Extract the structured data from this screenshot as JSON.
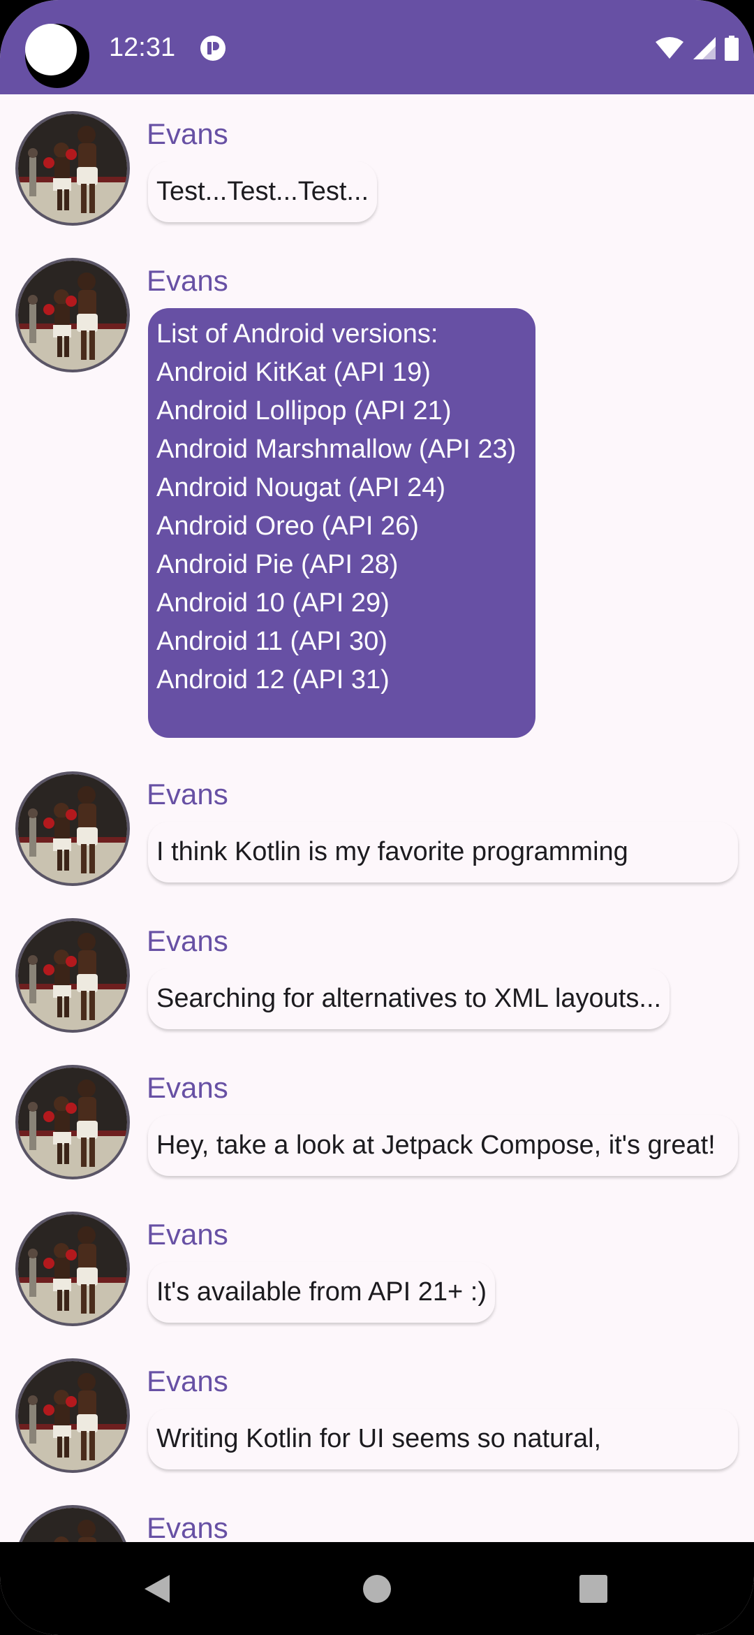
{
  "status_bar": {
    "time": "12:31",
    "icons": [
      "app-notification-icon",
      "wifi-icon",
      "cellular-signal-icon",
      "battery-icon"
    ]
  },
  "colors": {
    "primary": "#6750a4",
    "background": "#fdf7fb",
    "text": "#1c1b1f",
    "on_primary": "#ffffff"
  },
  "messages": [
    {
      "author": "Evans",
      "text": "Test...Test...Test...",
      "expanded": false
    },
    {
      "author": "Evans",
      "expanded": true,
      "lines": [
        "List of Android versions:",
        "Android KitKat (API 19)",
        "Android Lollipop (API 21)",
        "Android Marshmallow (API 23)",
        "Android Nougat (API 24)",
        "Android Oreo (API 26)",
        "Android Pie (API 28)",
        "Android 10 (API 29)",
        "Android 11 (API 30)",
        "Android 12 (API 31)"
      ]
    },
    {
      "author": "Evans",
      "text": "I think Kotlin is my favorite programming",
      "expanded": false
    },
    {
      "author": "Evans",
      "text": "Searching for alternatives to XML layouts...",
      "expanded": false
    },
    {
      "author": "Evans",
      "text": "Hey, take a look at Jetpack Compose, it's great!",
      "expanded": false
    },
    {
      "author": "Evans",
      "text": "It's available from API 21+ :)",
      "expanded": false
    },
    {
      "author": "Evans",
      "text": "Writing Kotlin for UI seems so natural,",
      "expanded": false
    },
    {
      "author": "Evans",
      "text": "",
      "expanded": false
    }
  ],
  "nav_bar": {
    "buttons": [
      "back-icon",
      "home-icon",
      "recents-icon"
    ]
  }
}
